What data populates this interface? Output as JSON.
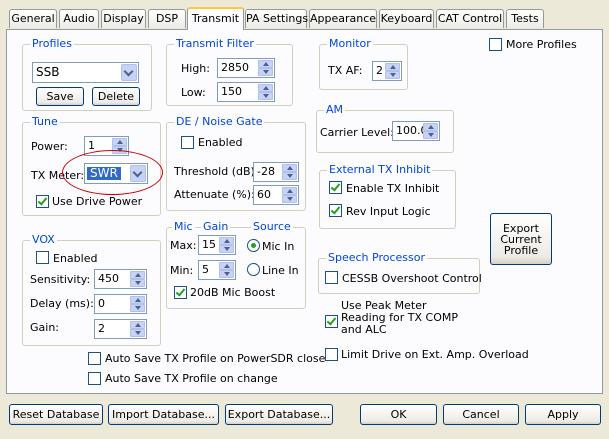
{
  "tabs": [
    "General",
    "Audio",
    "Display",
    "DSP",
    "Transmit",
    "PA Settings",
    "Appearance",
    "Keyboard",
    "CAT Control",
    "Tests"
  ],
  "active_tab": "Transmit",
  "profiles": {
    "title": "Profiles",
    "selected": "SSB",
    "save": "Save",
    "delete": "Delete"
  },
  "transmit_filter": {
    "title": "Transmit Filter",
    "high_label": "High:",
    "high": "2850",
    "low_label": "Low:",
    "low": "150"
  },
  "monitor": {
    "title": "Monitor",
    "txaf_label": "TX AF:",
    "txaf": "2"
  },
  "more_profiles": "More Profiles",
  "tune": {
    "title": "Tune",
    "power_label": "Power:",
    "power": "1",
    "txmeter_label": "TX Meter:",
    "txmeter": "SWR",
    "drive_power": "Use Drive Power",
    "highlight_color": "#d00000"
  },
  "de_noise": {
    "title": "DE / Noise Gate",
    "enabled": "Enabled",
    "threshold_label": "Threshold (dB):",
    "threshold": "-28",
    "attenuate_label": "Attenuate (%):",
    "attenuate": "60"
  },
  "am": {
    "title": "AM",
    "carrier_label": "Carrier Level:",
    "carrier": "100.0"
  },
  "ext_inhibit": {
    "title": "External TX Inhibit",
    "enable": "Enable TX Inhibit",
    "rev": "Rev Input Logic"
  },
  "export_profile": "Export Current Profile",
  "vox": {
    "title": "VOX",
    "enabled": "Enabled",
    "sensitivity_label": "Sensitivity:",
    "sensitivity": "450",
    "delay_label": "Delay (ms):",
    "delay": "0",
    "gain_label": "Gain:",
    "gain": "2"
  },
  "mic": {
    "title_mic": "Mic",
    "title_gain": "Gain",
    "title_source": "Source",
    "max_label": "Max:",
    "max": "15",
    "min_label": "Min:",
    "min": "5",
    "mic_in": "Mic In",
    "line_in": "Line In",
    "boost": "20dB Mic Boost"
  },
  "speech": {
    "title": "Speech Processor",
    "cessb": "CESSB Overshoot Control"
  },
  "peak_meter": "Use Peak Meter Reading for TX COMP and ALC",
  "limit_drive": "Limit Drive on Ext. Amp. Overload",
  "auto_save_close": "Auto Save TX Profile on PowerSDR close",
  "auto_save_change": "Auto Save TX Profile on change",
  "footer": {
    "reset": "Reset Database",
    "import": "Import Database...",
    "export": "Export Database...",
    "ok": "OK",
    "cancel": "Cancel",
    "apply": "Apply"
  }
}
